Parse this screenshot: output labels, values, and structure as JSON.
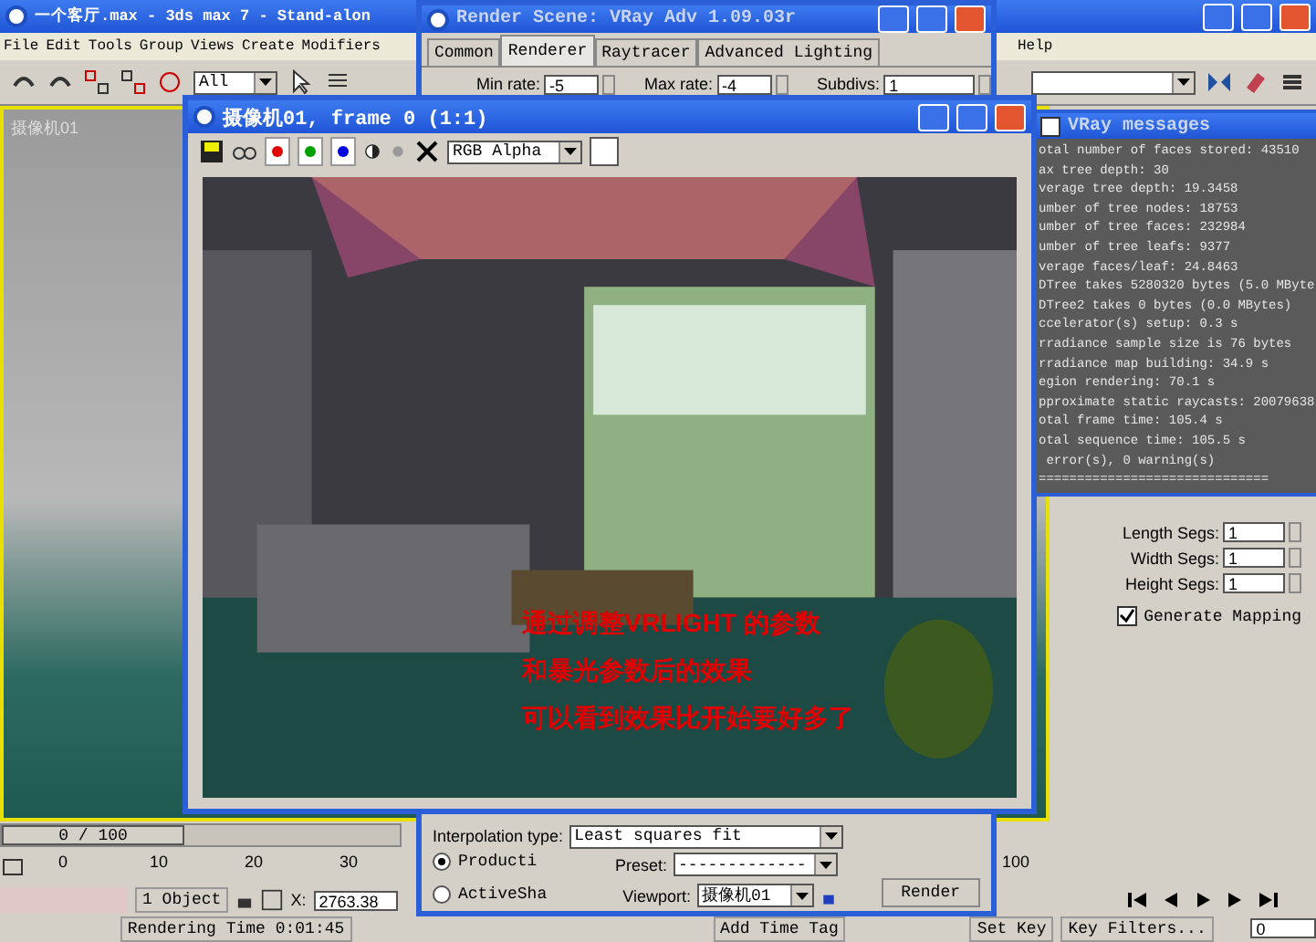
{
  "main_window": {
    "title": "一个客厅.max - 3ds max 7 - Stand-alon",
    "menu": [
      "File",
      "Edit",
      "Tools",
      "Group",
      "Views",
      "Create",
      "Modifiers",
      "Help"
    ],
    "selection_filter": "All",
    "viewport": {
      "label": "摄像机01"
    },
    "command_panel": {
      "spinners": [
        {
          "label": "Length Segs:",
          "value": "1"
        },
        {
          "label": "Width Segs:",
          "value": "1"
        },
        {
          "label": "Height Segs:",
          "value": "1"
        }
      ],
      "generate_mapping": {
        "label": "Generate Mapping",
        "checked": true
      }
    }
  },
  "time_slider": {
    "label": "0 / 100",
    "level": 0,
    "ticks": [
      "0",
      "10",
      "20",
      "30",
      "100"
    ]
  },
  "status_bar": {
    "selection": "1 Object",
    "x_label": "X:",
    "x_value": "2763.38",
    "prompt": "Rendering Time  0:01:45",
    "add_time_tag": "Add Time Tag",
    "set_key": "Set Key",
    "key_filters": "Key Filters...",
    "frame": "0"
  },
  "render_scene": {
    "title": "Render Scene: VRay Adv 1.09.03r",
    "tabs": [
      {
        "label": "Common",
        "selected": false
      },
      {
        "label": "Renderer",
        "selected": true
      },
      {
        "label": "Raytracer",
        "selected": false
      },
      {
        "label": "Advanced Lighting",
        "selected": false
      }
    ],
    "fields": [
      {
        "label": "Min rate:",
        "value": "-5"
      },
      {
        "label": "Max rate:",
        "value": "-4"
      },
      {
        "label": "Subdivs:",
        "value": "1"
      }
    ],
    "interpolation": {
      "label": "Interpolation type:",
      "value": "Least squares fit"
    },
    "modes": [
      {
        "label": "Producti",
        "selected": true
      },
      {
        "label": "ActiveSha",
        "selected": false
      }
    ],
    "preset": {
      "label": "Preset:",
      "value": "-------------"
    },
    "viewport": {
      "label": "Viewport:",
      "value": "摄像机01"
    },
    "render_button": "Render"
  },
  "frame_window": {
    "title": "摄像机01, frame 0 (1:1)",
    "channels": [
      {
        "color": "#e00000"
      },
      {
        "color": "#00a000"
      },
      {
        "color": "#0000e0"
      }
    ],
    "channel_select": "RGB Alpha",
    "annotations": [
      "通过调整VRLIGHT 的参数",
      "和暴光参数后的效果",
      "可以看到效果比开始要好多了"
    ]
  },
  "vray_messages": {
    "title": "VRay messages",
    "lines": [
      "otal number of faces stored: 43510",
      "ax tree depth: 30",
      "verage tree depth: 19.3458",
      "umber of tree nodes: 18753",
      "umber of tree faces: 232984",
      "umber of tree leafs: 9377",
      "verage faces/leaf: 24.8463",
      "DTree takes 5280320 bytes (5.0 MByte",
      "DTree2 takes 0 bytes (0.0 MBytes)",
      "ccelerator(s) setup: 0.3 s",
      "rradiance sample size is 76 bytes",
      "rradiance map building: 34.9 s",
      "egion rendering: 70.1 s",
      "pproximate static raycasts: 20079638",
      "otal frame time: 105.4 s",
      "otal sequence time: 105.5 s",
      " error(s), 0 warning(s)",
      "=============================="
    ]
  }
}
